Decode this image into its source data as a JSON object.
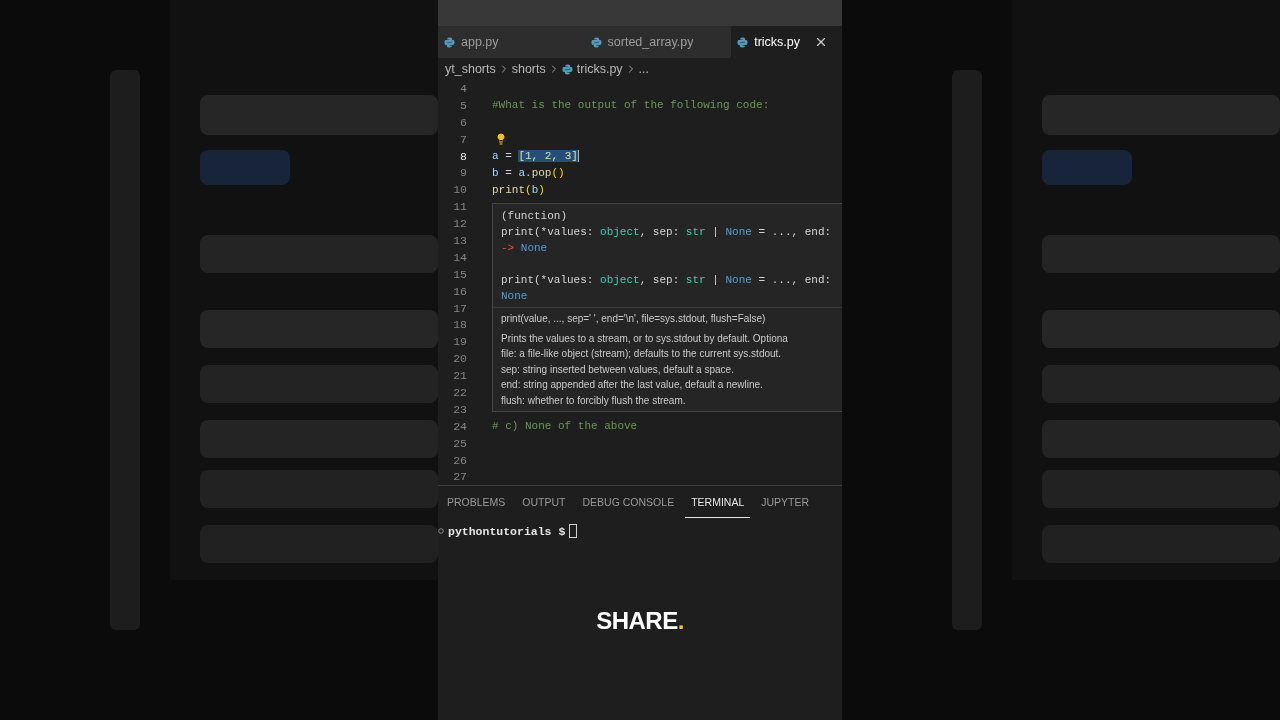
{
  "tabs": [
    {
      "name": "app.py",
      "selected": false
    },
    {
      "name": "sorted_array.py",
      "selected": false
    },
    {
      "name": "tricks.py",
      "selected": true
    }
  ],
  "breadcrumb": [
    {
      "text": "yt_shorts",
      "kind": "folder"
    },
    {
      "text": "shorts",
      "kind": "folder"
    },
    {
      "text": "tricks.py",
      "kind": "file"
    },
    {
      "text": "...",
      "kind": "more"
    }
  ],
  "editor": {
    "lines": [
      {
        "number": "4"
      },
      {
        "number": "5",
        "tokens": [
          {
            "t": "#What is the output of the following code:",
            "kind": "comment"
          }
        ]
      },
      {
        "number": "6"
      },
      {
        "number": "7",
        "lightbulb": true
      },
      {
        "number": "8",
        "current": true,
        "tokens": [
          {
            "t": "a",
            "kind": "var"
          },
          {
            "t": " = ",
            "kind": "op"
          },
          {
            "t": "[1, 2, 3]",
            "kind": "selection",
            "selected": true
          }
        ]
      },
      {
        "number": "9",
        "tokens": [
          {
            "t": "b",
            "kind": "var"
          },
          {
            "t": " = ",
            "kind": "op"
          },
          {
            "t": "a",
            "kind": "var"
          },
          {
            "t": ".",
            "kind": "op"
          },
          {
            "t": "pop",
            "kind": "func"
          },
          {
            "t": "()",
            "kind": "bracket"
          }
        ]
      },
      {
        "number": "10",
        "tokens": [
          {
            "t": "print",
            "kind": "func"
          },
          {
            "t": "(",
            "kind": "bracket"
          },
          {
            "t": "b",
            "kind": "var"
          },
          {
            "t": ")",
            "kind": "bracket"
          }
        ]
      },
      {
        "number": "11"
      },
      {
        "number": "12"
      },
      {
        "number": "13"
      },
      {
        "number": "14"
      },
      {
        "number": "15"
      },
      {
        "number": "16"
      },
      {
        "number": "17"
      },
      {
        "number": "18"
      },
      {
        "number": "19"
      },
      {
        "number": "20"
      },
      {
        "number": "21"
      },
      {
        "number": "22"
      },
      {
        "number": "23"
      },
      {
        "number": "24",
        "tokens": [
          {
            "t": "# c) None of the above",
            "kind": "comment"
          }
        ]
      },
      {
        "number": "25"
      },
      {
        "number": "26"
      },
      {
        "number": "27"
      }
    ]
  },
  "hover": {
    "header": "(function)",
    "signatures": [
      {
        "lines": [
          [
            {
              "t": "print(*values: ",
              "kind": "plain"
            },
            {
              "t": "object",
              "kind": "type"
            },
            {
              "t": ", sep: ",
              "kind": "plain"
            },
            {
              "t": "str",
              "kind": "type"
            },
            {
              "t": " | ",
              "kind": "plain"
            },
            {
              "t": "None",
              "kind": "const"
            },
            {
              "t": " = ..., end:",
              "kind": "plain"
            }
          ],
          [
            {
              "t": "->",
              "kind": "arrow"
            },
            {
              "t": " None",
              "kind": "const"
            }
          ]
        ]
      },
      {
        "lines": [
          [
            {
              "t": "print(*values: ",
              "kind": "plain"
            },
            {
              "t": "object",
              "kind": "type"
            },
            {
              "t": ", sep: ",
              "kind": "plain"
            },
            {
              "t": "str",
              "kind": "type"
            },
            {
              "t": " | ",
              "kind": "plain"
            },
            {
              "t": "None",
              "kind": "const"
            },
            {
              "t": " = ..., end:",
              "kind": "plain"
            }
          ],
          [
            {
              "t": "None",
              "kind": "const"
            }
          ]
        ]
      }
    ],
    "usage": "print(value, ..., sep=' ', end='\\n', file=sys.stdout, flush=False)",
    "doc": [
      "Prints the values to a stream, or to sys.stdout by default. Optiona",
      "file: a file-like object (stream); defaults to the current sys.stdout.",
      "sep: string inserted between values, default a space.",
      "end: string appended after the last value, default a newline.",
      "flush: whether to forcibly flush the stream."
    ]
  },
  "panel": {
    "tabs": [
      {
        "label": "PROBLEMS",
        "selected": false
      },
      {
        "label": "OUTPUT",
        "selected": false
      },
      {
        "label": "DEBUG CONSOLE",
        "selected": false
      },
      {
        "label": "TERMINAL",
        "selected": true
      },
      {
        "label": "JUPYTER",
        "selected": false
      }
    ],
    "prompt": "pythontutorials $"
  },
  "caption": {
    "text": "SHARE",
    "accent": "."
  }
}
